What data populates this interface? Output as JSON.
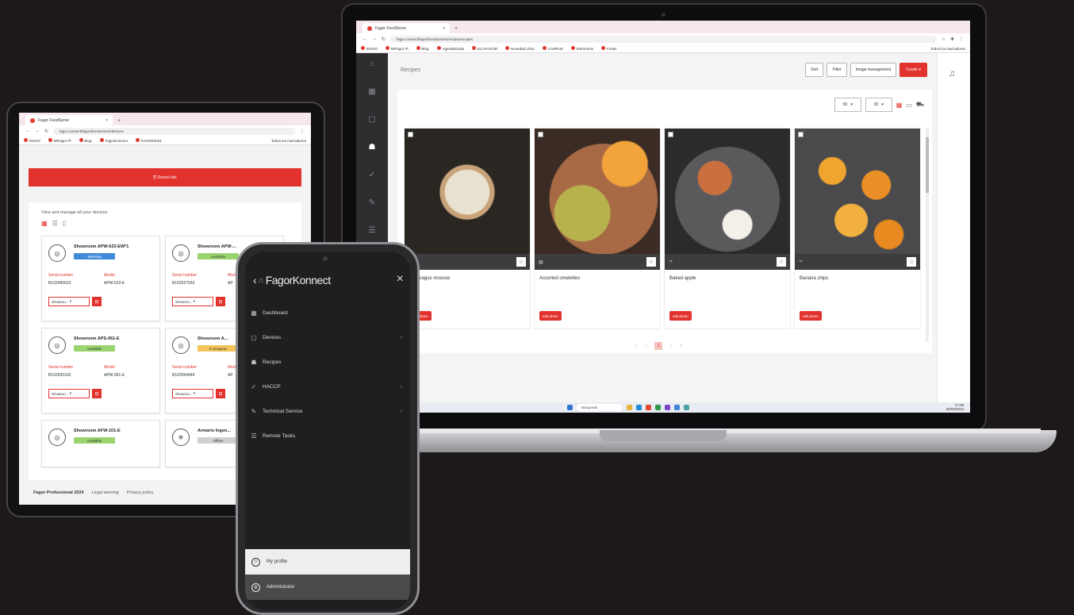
{
  "laptop": {
    "browser": {
      "tab_title": "Fagor FoodServe",
      "tab_close": "×",
      "new_tab": "+",
      "url": "fagor.connect/fagor/fonokonnect/recipes/recipes",
      "bookmarks": [
        "INICIO",
        "MiFagor Pl",
        "Blog",
        "AgendaGuide",
        "ECAFAGOR",
        "Novedad Uriss",
        "CAMPUS",
        "Elementos",
        "Fosas"
      ],
      "bookmarks_right": "Todos los marcadores"
    },
    "app": {
      "page_title": "Recipes",
      "buttons": [
        "Sort",
        "Filter",
        "Image management"
      ],
      "create_label": "Create",
      "select_a": "50",
      "select_b": "30",
      "cards": [
        {
          "name": "Asparagus mousse",
          "pill": "edit photo",
          "strip": ""
        },
        {
          "name": "Assorted omelettes",
          "pill": "edit photo",
          "strip": "lbl"
        },
        {
          "name": "Baked apple",
          "pill": "edit photo",
          "strip": ""
        },
        {
          "name": "Banana chips",
          "pill": "edit photo",
          "strip": ""
        }
      ],
      "pager": [
        "«",
        "‹",
        "1",
        "›",
        "»"
      ]
    },
    "taskbar": {
      "search_placeholder": "Búsqueda",
      "time": "17:05",
      "date": "25/04/2024"
    }
  },
  "tablet": {
    "browser": {
      "tab_title": "Fagor FoodServe",
      "url": "fagor.connect/fagor/fonokonnect/devices",
      "bookmarks": [
        "INICIO",
        "MiFagor Pl",
        "Blog",
        "FagorKonnect",
        "FAGOR2024"
      ],
      "bookmarks_right": "Todos los marcadores"
    },
    "device_link_label": "Device link",
    "intro_text": "View and manage all your devices",
    "devices": [
      {
        "name": "Showroom APW-623-EW*1",
        "status": "Washing",
        "status_color": "#3f8ad9",
        "serial_label": "Serial number",
        "serial": "B102495633",
        "model_label": "Model",
        "model": "APW-623-E",
        "select": "Showroo..."
      },
      {
        "name": "Showroom APW-...",
        "status": "Available",
        "status_color": "#9ad46f",
        "serial_label": "Serial number",
        "serial": "B102527933",
        "model_label": "Model",
        "model": "AP",
        "select": "Showroo..."
      },
      {
        "name": "Showroom APS-061-E",
        "status": "Available",
        "status_color": "#9ad46f",
        "serial_label": "Serial number",
        "serial": "B102595100",
        "model_label": "Model",
        "model": "APW-061-E",
        "select": "Showroo..."
      },
      {
        "name": "Showroom A...",
        "status": "In progress",
        "status_color": "#f4c55a",
        "serial_label": "Serial number",
        "serial": "B102564449",
        "model_label": "Model",
        "model": "AP",
        "select": "Showroo..."
      },
      {
        "name": "Showroom AFW-101-E",
        "status": "Available",
        "status_color": "#9ad46f",
        "serial_label": "",
        "serial": "",
        "model_label": "",
        "model": "",
        "select": ""
      },
      {
        "name": "Armario Ingen...",
        "status": "Offline",
        "status_color": "#d0d0d0",
        "serial_label": "",
        "serial": "",
        "model_label": "",
        "model": "",
        "select": ""
      }
    ],
    "footer": {
      "copyright": "Fagor Professional 2024",
      "legal": "Legal warning",
      "privacy": "Privacy policy"
    }
  },
  "phone": {
    "logo": "FagorKonnect",
    "close": "×",
    "nav": [
      {
        "label": "Dashboard",
        "has_chevron": false
      },
      {
        "label": "Devices",
        "has_chevron": true
      },
      {
        "label": "Recipes",
        "has_chevron": false
      },
      {
        "label": "HACCP",
        "has_chevron": true
      },
      {
        "label": "Technical Service",
        "has_chevron": true
      },
      {
        "label": "Remote Tasks",
        "has_chevron": false
      }
    ],
    "chevron": "›",
    "profile_label": "My profile",
    "admin_label": "Administrator"
  },
  "colors": {
    "brand_red": "#e2322e",
    "dark_bg": "#1d1819",
    "rail": "#2d2d30"
  }
}
